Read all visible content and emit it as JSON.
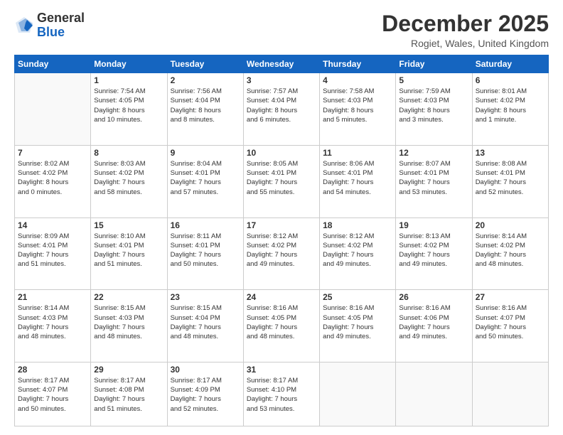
{
  "header": {
    "logo_general": "General",
    "logo_blue": "Blue",
    "month_title": "December 2025",
    "location": "Rogiet, Wales, United Kingdom"
  },
  "weekdays": [
    "Sunday",
    "Monday",
    "Tuesday",
    "Wednesday",
    "Thursday",
    "Friday",
    "Saturday"
  ],
  "weeks": [
    [
      {
        "day": "",
        "info": ""
      },
      {
        "day": "1",
        "info": "Sunrise: 7:54 AM\nSunset: 4:05 PM\nDaylight: 8 hours\nand 10 minutes."
      },
      {
        "day": "2",
        "info": "Sunrise: 7:56 AM\nSunset: 4:04 PM\nDaylight: 8 hours\nand 8 minutes."
      },
      {
        "day": "3",
        "info": "Sunrise: 7:57 AM\nSunset: 4:04 PM\nDaylight: 8 hours\nand 6 minutes."
      },
      {
        "day": "4",
        "info": "Sunrise: 7:58 AM\nSunset: 4:03 PM\nDaylight: 8 hours\nand 5 minutes."
      },
      {
        "day": "5",
        "info": "Sunrise: 7:59 AM\nSunset: 4:03 PM\nDaylight: 8 hours\nand 3 minutes."
      },
      {
        "day": "6",
        "info": "Sunrise: 8:01 AM\nSunset: 4:02 PM\nDaylight: 8 hours\nand 1 minute."
      }
    ],
    [
      {
        "day": "7",
        "info": "Sunrise: 8:02 AM\nSunset: 4:02 PM\nDaylight: 8 hours\nand 0 minutes."
      },
      {
        "day": "8",
        "info": "Sunrise: 8:03 AM\nSunset: 4:02 PM\nDaylight: 7 hours\nand 58 minutes."
      },
      {
        "day": "9",
        "info": "Sunrise: 8:04 AM\nSunset: 4:01 PM\nDaylight: 7 hours\nand 57 minutes."
      },
      {
        "day": "10",
        "info": "Sunrise: 8:05 AM\nSunset: 4:01 PM\nDaylight: 7 hours\nand 55 minutes."
      },
      {
        "day": "11",
        "info": "Sunrise: 8:06 AM\nSunset: 4:01 PM\nDaylight: 7 hours\nand 54 minutes."
      },
      {
        "day": "12",
        "info": "Sunrise: 8:07 AM\nSunset: 4:01 PM\nDaylight: 7 hours\nand 53 minutes."
      },
      {
        "day": "13",
        "info": "Sunrise: 8:08 AM\nSunset: 4:01 PM\nDaylight: 7 hours\nand 52 minutes."
      }
    ],
    [
      {
        "day": "14",
        "info": "Sunrise: 8:09 AM\nSunset: 4:01 PM\nDaylight: 7 hours\nand 51 minutes."
      },
      {
        "day": "15",
        "info": "Sunrise: 8:10 AM\nSunset: 4:01 PM\nDaylight: 7 hours\nand 51 minutes."
      },
      {
        "day": "16",
        "info": "Sunrise: 8:11 AM\nSunset: 4:01 PM\nDaylight: 7 hours\nand 50 minutes."
      },
      {
        "day": "17",
        "info": "Sunrise: 8:12 AM\nSunset: 4:02 PM\nDaylight: 7 hours\nand 49 minutes."
      },
      {
        "day": "18",
        "info": "Sunrise: 8:12 AM\nSunset: 4:02 PM\nDaylight: 7 hours\nand 49 minutes."
      },
      {
        "day": "19",
        "info": "Sunrise: 8:13 AM\nSunset: 4:02 PM\nDaylight: 7 hours\nand 49 minutes."
      },
      {
        "day": "20",
        "info": "Sunrise: 8:14 AM\nSunset: 4:02 PM\nDaylight: 7 hours\nand 48 minutes."
      }
    ],
    [
      {
        "day": "21",
        "info": "Sunrise: 8:14 AM\nSunset: 4:03 PM\nDaylight: 7 hours\nand 48 minutes."
      },
      {
        "day": "22",
        "info": "Sunrise: 8:15 AM\nSunset: 4:03 PM\nDaylight: 7 hours\nand 48 minutes."
      },
      {
        "day": "23",
        "info": "Sunrise: 8:15 AM\nSunset: 4:04 PM\nDaylight: 7 hours\nand 48 minutes."
      },
      {
        "day": "24",
        "info": "Sunrise: 8:16 AM\nSunset: 4:05 PM\nDaylight: 7 hours\nand 48 minutes."
      },
      {
        "day": "25",
        "info": "Sunrise: 8:16 AM\nSunset: 4:05 PM\nDaylight: 7 hours\nand 49 minutes."
      },
      {
        "day": "26",
        "info": "Sunrise: 8:16 AM\nSunset: 4:06 PM\nDaylight: 7 hours\nand 49 minutes."
      },
      {
        "day": "27",
        "info": "Sunrise: 8:16 AM\nSunset: 4:07 PM\nDaylight: 7 hours\nand 50 minutes."
      }
    ],
    [
      {
        "day": "28",
        "info": "Sunrise: 8:17 AM\nSunset: 4:07 PM\nDaylight: 7 hours\nand 50 minutes."
      },
      {
        "day": "29",
        "info": "Sunrise: 8:17 AM\nSunset: 4:08 PM\nDaylight: 7 hours\nand 51 minutes."
      },
      {
        "day": "30",
        "info": "Sunrise: 8:17 AM\nSunset: 4:09 PM\nDaylight: 7 hours\nand 52 minutes."
      },
      {
        "day": "31",
        "info": "Sunrise: 8:17 AM\nSunset: 4:10 PM\nDaylight: 7 hours\nand 53 minutes."
      },
      {
        "day": "",
        "info": ""
      },
      {
        "day": "",
        "info": ""
      },
      {
        "day": "",
        "info": ""
      }
    ]
  ]
}
